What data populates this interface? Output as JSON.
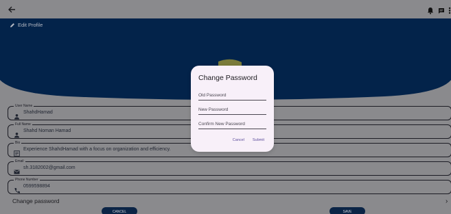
{
  "topbar": {
    "back_icon": "arrow-left-icon",
    "right_icons": [
      "bell-icon",
      "chat-icon",
      "more-vert-icon"
    ]
  },
  "header": {
    "title": "Edit Profile",
    "icon": "pencil-icon",
    "colors": {
      "banner": "#03234a",
      "avatar": "#7a7b3a"
    }
  },
  "fields": [
    {
      "label": "User Name",
      "value": "ShahdHamad",
      "icon": "person-icon"
    },
    {
      "label": "Full Name",
      "value": "Shahd Noman Hamad",
      "icon": "person-icon"
    },
    {
      "label": "Bio",
      "value": "Experience ShahdHamad with a focus on organization and efficiency.",
      "icon": "article-icon"
    },
    {
      "label": "Email",
      "value": "sh.3182002@gmail.com",
      "icon": "email-icon"
    },
    {
      "label": "Phone Number",
      "value": "0599598894",
      "icon": "phone-icon"
    }
  ],
  "change_password_row": {
    "label": "Change password",
    "icon": "chevron-right-icon"
  },
  "buttons": {
    "cancel": "CANCEL",
    "save": "SAVE"
  },
  "dialog": {
    "title": "Change Password",
    "fields": [
      {
        "placeholder": "Old Password",
        "value": ""
      },
      {
        "placeholder": "New Password",
        "value": ""
      },
      {
        "placeholder": "Confirm New Password",
        "value": ""
      }
    ],
    "cancel_label": "Cancel",
    "submit_label": "Submit"
  }
}
